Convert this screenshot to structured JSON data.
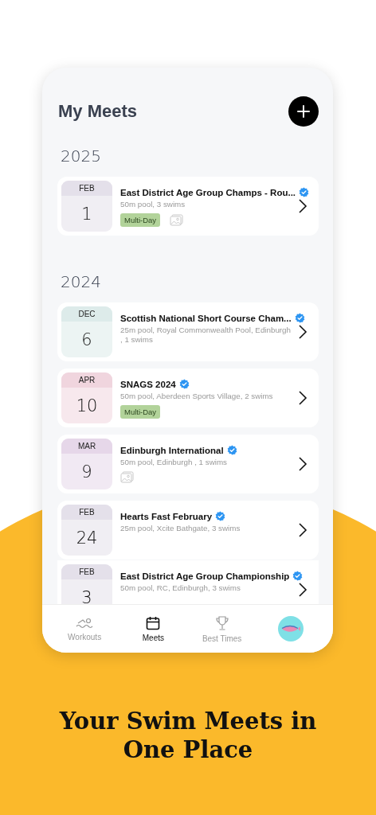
{
  "screen": {
    "title": "My Meets"
  },
  "years": [
    {
      "year": "2025",
      "meets": [
        {
          "month": "FEB",
          "day": "1",
          "color": "#e4e0ea",
          "title": "East District Age Group Champs - Rou...",
          "verified": true,
          "details": "50m pool, 3 swims",
          "tag": "Multi-Day",
          "photo": true
        }
      ]
    },
    {
      "year": "2024",
      "meets": [
        {
          "month": "DEC",
          "day": "6",
          "color": "#ddebea",
          "title": "Scottish National Short Course Cham...",
          "verified": true,
          "details": "25m pool, Royal Commonwealth Pool, Edinburgh , 1 swims",
          "photo": false
        },
        {
          "month": "APR",
          "day": "10",
          "color": "#f0d5de",
          "title": "SNAGS 2024",
          "verified": true,
          "details": "50m pool, Aberdeen Sports Village, 2 swims",
          "tag": "Multi-Day",
          "photo": false
        },
        {
          "month": "MAR",
          "day": "9",
          "color": "#e6d7e9",
          "title": "Edinburgh International",
          "verified": true,
          "details": "50m pool, Edinburgh , 1 swims",
          "photo": true
        },
        {
          "month": "FEB",
          "day": "24",
          "color": "#e4e0ea",
          "title": "Hearts Fast February",
          "verified": true,
          "details": "25m pool, Xcite Bathgate, 3 swims",
          "photo": false
        },
        {
          "month": "FEB",
          "day": "3",
          "color": "#e4e0ea",
          "title": "East District Age Group Championship",
          "verified": true,
          "details": "50m pool, RC, Edinburgh, 3 swims",
          "photo": false,
          "joined": true
        }
      ]
    }
  ],
  "tabs": [
    {
      "kind": "swim",
      "label": "Workouts",
      "selected": false
    },
    {
      "kind": "calendar",
      "label": "Meets",
      "selected": true
    },
    {
      "kind": "trophy",
      "label": "Best Times",
      "selected": false
    },
    {
      "kind": "avatar",
      "selected": false
    }
  ],
  "headline": [
    "Your Swim Meets in",
    "One Place"
  ]
}
